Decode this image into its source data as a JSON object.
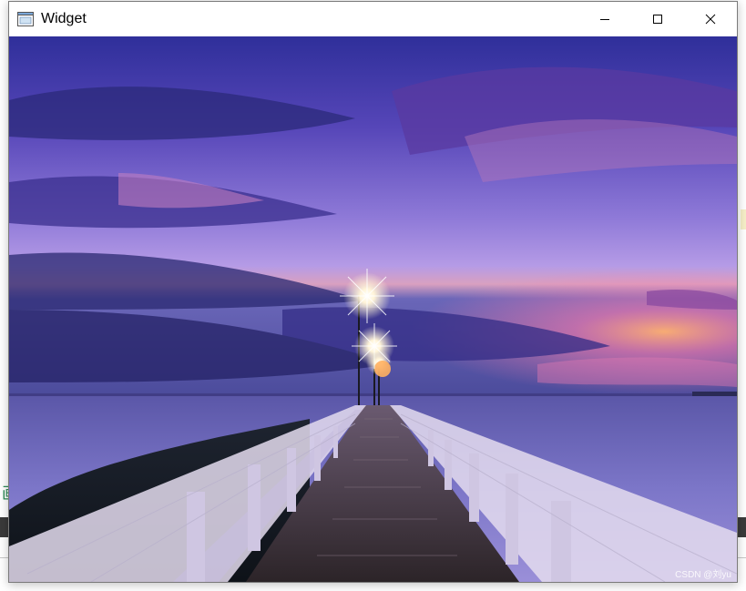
{
  "window": {
    "title": "Widget",
    "icon": "qt-widget-app-icon",
    "controls": {
      "minimize_icon": "minimize-icon",
      "maximize_icon": "maximize-icon",
      "close_icon": "close-icon"
    }
  },
  "content": {
    "image_subject": "pier-at-dusk",
    "watermark": "CSDN @刘yu"
  },
  "background": {
    "bottom_glyph": "画"
  },
  "colors": {
    "sky_top": "#3d3aa6",
    "sky_mid": "#8a6cd8",
    "horizon_glow": "#ff9a6a",
    "water": "#6a66b8",
    "pier_deck": "#3a2f35",
    "rail": "#d8cfe6"
  }
}
